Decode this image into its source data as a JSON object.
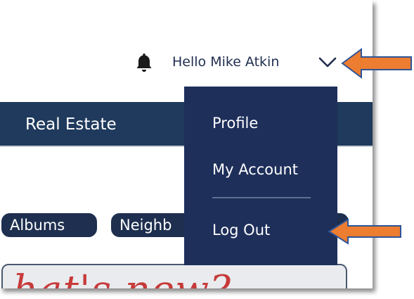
{
  "header": {
    "greeting": "Hello Mike Atkin",
    "icons": {
      "notifications": "bell-icon",
      "account_menu": "chevron-down-icon"
    }
  },
  "navbar": {
    "items": [
      {
        "label": "Real Estate"
      }
    ]
  },
  "account_menu": {
    "items": [
      {
        "label": "Profile"
      },
      {
        "label": "My Account"
      },
      {
        "label": "Log Out"
      }
    ]
  },
  "content": {
    "pills": [
      {
        "label": "Albums"
      },
      {
        "label": "Neighb"
      }
    ],
    "banner_text": "hat's new?"
  },
  "annotations": {
    "arrow_color": "#ed7d31",
    "arrow_outline": "#2f5597"
  },
  "colors": {
    "navbar": "#1f3a5c",
    "dropdown": "#1e2f5a",
    "pill": "#1e2f4f",
    "banner_text": "#c73a3a"
  }
}
